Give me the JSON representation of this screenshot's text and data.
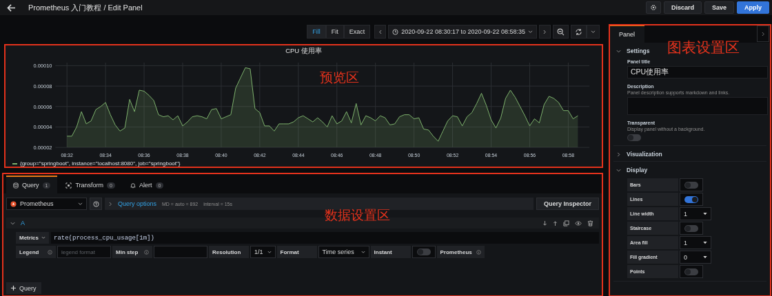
{
  "header": {
    "title": "Prometheus 入门教程 / Edit Panel",
    "buttons": [
      {
        "label": "Discard",
        "kind": "secondary"
      },
      {
        "label": "Save",
        "kind": "secondary"
      },
      {
        "label": "Apply",
        "kind": "primary"
      }
    ]
  },
  "toolbar": {
    "fit_modes": [
      {
        "label": "Fill",
        "selected": true
      },
      {
        "label": "Fit",
        "selected": false
      },
      {
        "label": "Exact",
        "selected": false
      }
    ],
    "time_range": "2020-09-22 08:30:17 to 2020-09-22 08:58:35"
  },
  "preview": {
    "title": "CPU 使用率",
    "annotation": "预览区",
    "chart_data": {
      "type": "area",
      "categories": [
        "08:32",
        null,
        null,
        null,
        null,
        null,
        null,
        null,
        "08:34",
        null,
        null,
        null,
        null,
        null,
        null,
        null,
        "08:36",
        null,
        null,
        null,
        null,
        null,
        null,
        null,
        "08:38",
        null,
        null,
        null,
        null,
        null,
        null,
        null,
        "08:40",
        null,
        null,
        null,
        null,
        null,
        null,
        null,
        "08:42",
        null,
        null,
        null,
        null,
        null,
        null,
        null,
        "08:44",
        null,
        null,
        null,
        null,
        null,
        null,
        null,
        "08:46",
        null,
        null,
        null,
        null,
        null,
        null,
        null,
        "08:48",
        null,
        null,
        null,
        null,
        null,
        null,
        null,
        "08:50",
        null,
        null,
        null,
        null,
        null,
        null,
        null,
        "08:52",
        null,
        null,
        null,
        null,
        null,
        null,
        null,
        "08:54",
        null,
        null,
        null,
        null,
        null,
        null,
        null,
        "08:56",
        null,
        null,
        null,
        null,
        null,
        null,
        null,
        "08:58",
        null,
        null
      ],
      "series": [
        {
          "name": "{group=\"springboot\", instance=\"localhost:8080\", job=\"springboot\"}",
          "color": "#7eb26d",
          "values": [
            3.1e-05,
            3.1e-05,
            4e-05,
            5.5e-05,
            4.3e-05,
            4.6e-05,
            5.7e-05,
            6e-05,
            6.4e-05,
            5.2e-05,
            4.2e-05,
            3.6e-05,
            3.9e-05,
            6.7e-05,
            5.5e-05,
            7.6e-05,
            7.5e-05,
            7.1e-05,
            6.6e-05,
            5.2e-05,
            5e-05,
            5.1e-05,
            4.7e-05,
            5.1e-05,
            4.1e-05,
            4.5e-05,
            5e-05,
            5.1e-05,
            5e-05,
            4.8e-05,
            5.7e-05,
            5.8e-05,
            4.8e-05,
            5e-05,
            5.2e-05,
            7.8e-05,
            8.8e-05,
            9.8e-05,
            9.7e-05,
            5.8e-05,
            5.4e-05,
            4.1e-05,
            4.1e-05,
            3.6e-05,
            4.3e-05,
            4.3e-05,
            4.3e-05,
            4.5e-05,
            4.9e-05,
            5.1e-05,
            4.8e-05,
            4.5e-05,
            4.9e-05,
            4.5e-05,
            4e-05,
            5.1e-05,
            4.3e-05,
            4.6e-05,
            5.5e-05,
            4.4e-05,
            6.3e-05,
            4.2e-05,
            5.1e-05,
            4.9e-05,
            4.6e-05,
            5.1e-05,
            4.9e-05,
            4.2e-05,
            4.3e-05,
            5e-05,
            5.2e-05,
            5.2e-05,
            4.8e-05,
            4.9e-05,
            3.8e-05,
            3.7e-05,
            3.1e-05,
            2.6e-05,
            3.6e-05,
            4.6e-05,
            5.1e-05,
            5e-05,
            4.1e-05,
            5e-05,
            5.4e-05,
            6.3e-05,
            7.3e-05,
            6.1e-05,
            4.7e-05,
            3.9e-05,
            4.9e-05,
            6.8e-05,
            7.6e-05,
            6.9e-05,
            6e-05,
            5.1e-05,
            4.1e-05,
            4.8e-05,
            4.4e-05,
            6.2e-05,
            7e-05,
            6.8e-05,
            6.4e-05,
            5.6e-05,
            5.6e-05,
            4.8e-05,
            5.1e-05
          ]
        }
      ],
      "ylim": [
        2e-05,
        0.000103
      ],
      "grid": true,
      "yticks": [
        {
          "value": 2e-05,
          "label": "0.00002"
        },
        {
          "value": 4e-05,
          "label": "0.00004"
        },
        {
          "value": 6e-05,
          "label": "0.00006"
        },
        {
          "value": 8e-05,
          "label": "0.00008"
        },
        {
          "value": 0.0001,
          "label": "0.00010"
        }
      ]
    }
  },
  "query_editor": {
    "annotation": "数据设置区",
    "tabs": [
      {
        "label": "Query",
        "count": "1",
        "kind": "query",
        "selected": true
      },
      {
        "label": "Transform",
        "count": "0",
        "kind": "transform",
        "selected": false
      },
      {
        "label": "Alert",
        "count": "0",
        "kind": "alert",
        "selected": false
      }
    ],
    "datasource": "Prometheus",
    "query_options": {
      "label": "Query options",
      "md": "MD = auto = 892",
      "interval": "interval = 15s"
    },
    "inspector_button": "Query Inspector",
    "queries": [
      {
        "ref": "A",
        "expanded": true,
        "metrics_label": "Metrics",
        "expression": "rate(process_cpu_usage[1m])",
        "options": [
          {
            "kind": "label",
            "text": "Legend",
            "info": true
          },
          {
            "kind": "input",
            "placeholder": "legend format"
          },
          {
            "kind": "label",
            "text": "Min step",
            "info": true
          },
          {
            "kind": "input"
          },
          {
            "kind": "label",
            "text": "Resolution",
            "info": false
          },
          {
            "kind": "select",
            "value": "1/1"
          },
          {
            "kind": "label",
            "text": "Format",
            "info": false
          },
          {
            "kind": "select",
            "value": "Time series"
          },
          {
            "kind": "label",
            "text": "Instant",
            "info": false
          },
          {
            "kind": "toggle",
            "on": false
          },
          {
            "kind": "label",
            "text": "Prometheus",
            "info": true
          }
        ]
      }
    ],
    "add_button": "Query"
  },
  "options_pane": {
    "annotation": "图表设置区",
    "tabs": [
      {
        "label": "Panel",
        "selected": true
      }
    ],
    "sections": [
      {
        "title": "Settings",
        "expanded": true,
        "kind": "fields",
        "fields": [
          {
            "kind": "input",
            "label": "Panel title",
            "value": "CPU使用率"
          },
          {
            "kind": "textarea",
            "label": "Description",
            "hint": "Panel description supports markdown and links."
          },
          {
            "kind": "toggle",
            "label": "Transparent",
            "hint": "Display panel without a background.",
            "on": false
          }
        ]
      },
      {
        "title": "Visualization",
        "expanded": false
      },
      {
        "title": "Display",
        "expanded": true,
        "kind": "rows",
        "rows": [
          {
            "label": "Bars",
            "kind": "toggle",
            "on": false
          },
          {
            "label": "Lines",
            "kind": "toggle",
            "on": true
          },
          {
            "label": "Line width",
            "kind": "select",
            "value": "1"
          },
          {
            "label": "Staircase",
            "kind": "toggle",
            "on": false
          },
          {
            "label": "Area fill",
            "kind": "select",
            "value": "1"
          },
          {
            "label": "Fill gradient",
            "kind": "select",
            "value": "0"
          },
          {
            "label": "Points",
            "kind": "toggle",
            "on": false
          }
        ]
      }
    ]
  }
}
